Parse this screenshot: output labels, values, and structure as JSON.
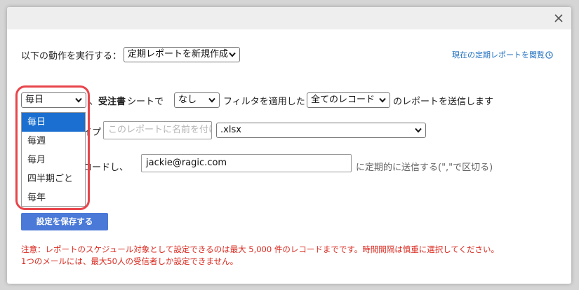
{
  "header": {
    "close_label": "×"
  },
  "action": {
    "label": "以下の動作を実行する：",
    "value": "定期レポートを新規作成",
    "view_link": "現在の定期レポートを閲覧"
  },
  "schedule_row": {
    "frequency_value": "毎日",
    "sheet_text_pre": "、",
    "sheet_name": "受注書",
    "sheet_text_post": "シートで",
    "filter_value": "なし",
    "filter_text": "フィルタを適用した",
    "records_value": "全てのレコード",
    "send_text": "のレポートを送信します"
  },
  "file_row": {
    "label_visible": "イプ",
    "name_placeholder": "このレポートに名前を付けてください",
    "format_value": ".xlsx"
  },
  "email_row": {
    "label_visible": "ロードし、",
    "email_value": "jackie@ragic.com",
    "hint": "に定期的に送信する(\",\"で区切る)"
  },
  "frequency_options": [
    {
      "label": "毎日",
      "selected": true
    },
    {
      "label": "毎週",
      "selected": false
    },
    {
      "label": "毎月",
      "selected": false
    },
    {
      "label": "四半期ごと",
      "selected": false
    },
    {
      "label": "毎年",
      "selected": false
    }
  ],
  "save_button": "設定を保存する",
  "notice": {
    "line1": "注意：レポートのスケジュール対象として設定できるのは最大 5,000 件のレコードまでです。時間間隔は慎重に選択してください。",
    "line2": "1つのメールには、最大50人の受信者しか設定できません。"
  },
  "colors": {
    "accent": "#4a79d8",
    "link": "#1f6fbf",
    "warning": "#d9281e",
    "highlight": "#e8454b",
    "selected_option": "#1a6fd0"
  },
  "icons": [
    "close-icon",
    "clock-icon",
    "chevron-down-icon"
  ]
}
